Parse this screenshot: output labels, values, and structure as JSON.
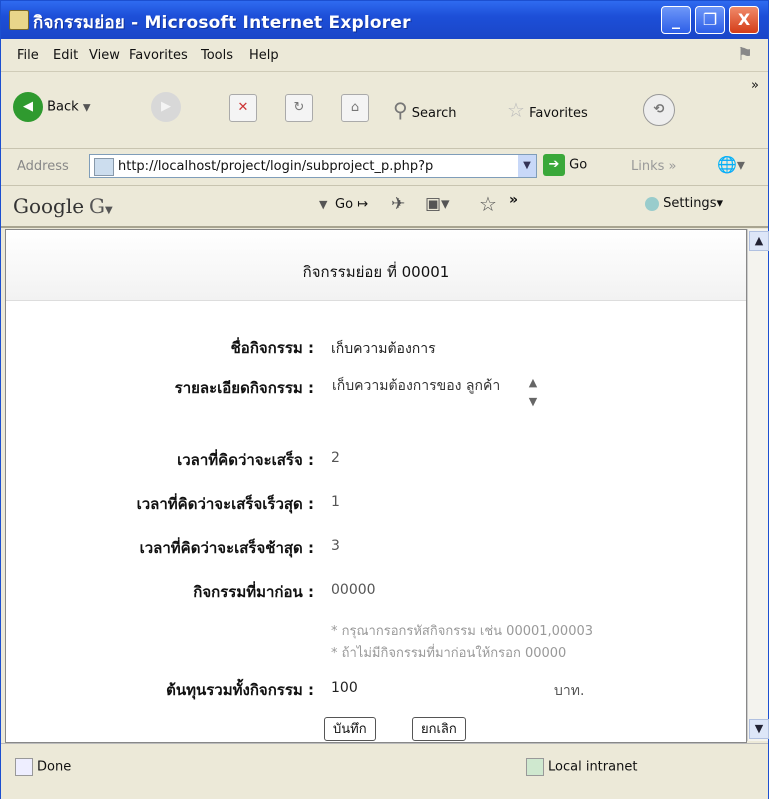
{
  "window": {
    "title": "กิจกรรมย่อย - Microsoft Internet Explorer",
    "minimize": "_",
    "restore": "❐",
    "close": "X"
  },
  "menu": [
    "File",
    "Edit",
    "View",
    "Favorites",
    "Tools",
    "Help"
  ],
  "toolbar": {
    "back": "Back",
    "search": "Search",
    "favorites": "Favorites",
    "more": "»"
  },
  "address": {
    "label": "Address",
    "url": "http://localhost/project/login/subproject_p.php?p",
    "go": "Go",
    "links": "Links"
  },
  "google": {
    "logo": "Google",
    "g_button": "G",
    "go": "Go",
    "settings": "Settings"
  },
  "page": {
    "title": "กิจกรรมย่อย ที่ 00001",
    "fields": [
      {
        "label": "ชื่อกิจกรรม :",
        "value": "เก็บความต้องการ"
      },
      {
        "label": "รายละเอียดกิจกรรม :",
        "value": "เก็บความต้องการของ ลูกค้า"
      },
      {
        "label": "เวลาที่คิดว่าจะเสร็จ :",
        "value": "2"
      },
      {
        "label": "เวลาที่คิดว่าจะเสร็จเร็วสุด :",
        "value": "1"
      },
      {
        "label": "เวลาที่คิดว่าจะเสร็จช้าสุด :",
        "value": "3"
      },
      {
        "label": "กิจกรรมที่มาก่อน :",
        "value": "00000"
      },
      {
        "label": "ต้นทุนรวมทั้งกิจกรรม :",
        "value": "100"
      }
    ],
    "hint1": "* กรุณากรอกรหัสกิจกรรม เช่น 00001,00003",
    "hint2": "* ถ้าไม่มีกิจกรรมที่มาก่อนให้กรอก 00000",
    "currency": "บาท.",
    "save_button": "บันทึก",
    "cancel_button": "ยกเลิก"
  },
  "status": {
    "left": "Done",
    "right": "Local intranet"
  }
}
